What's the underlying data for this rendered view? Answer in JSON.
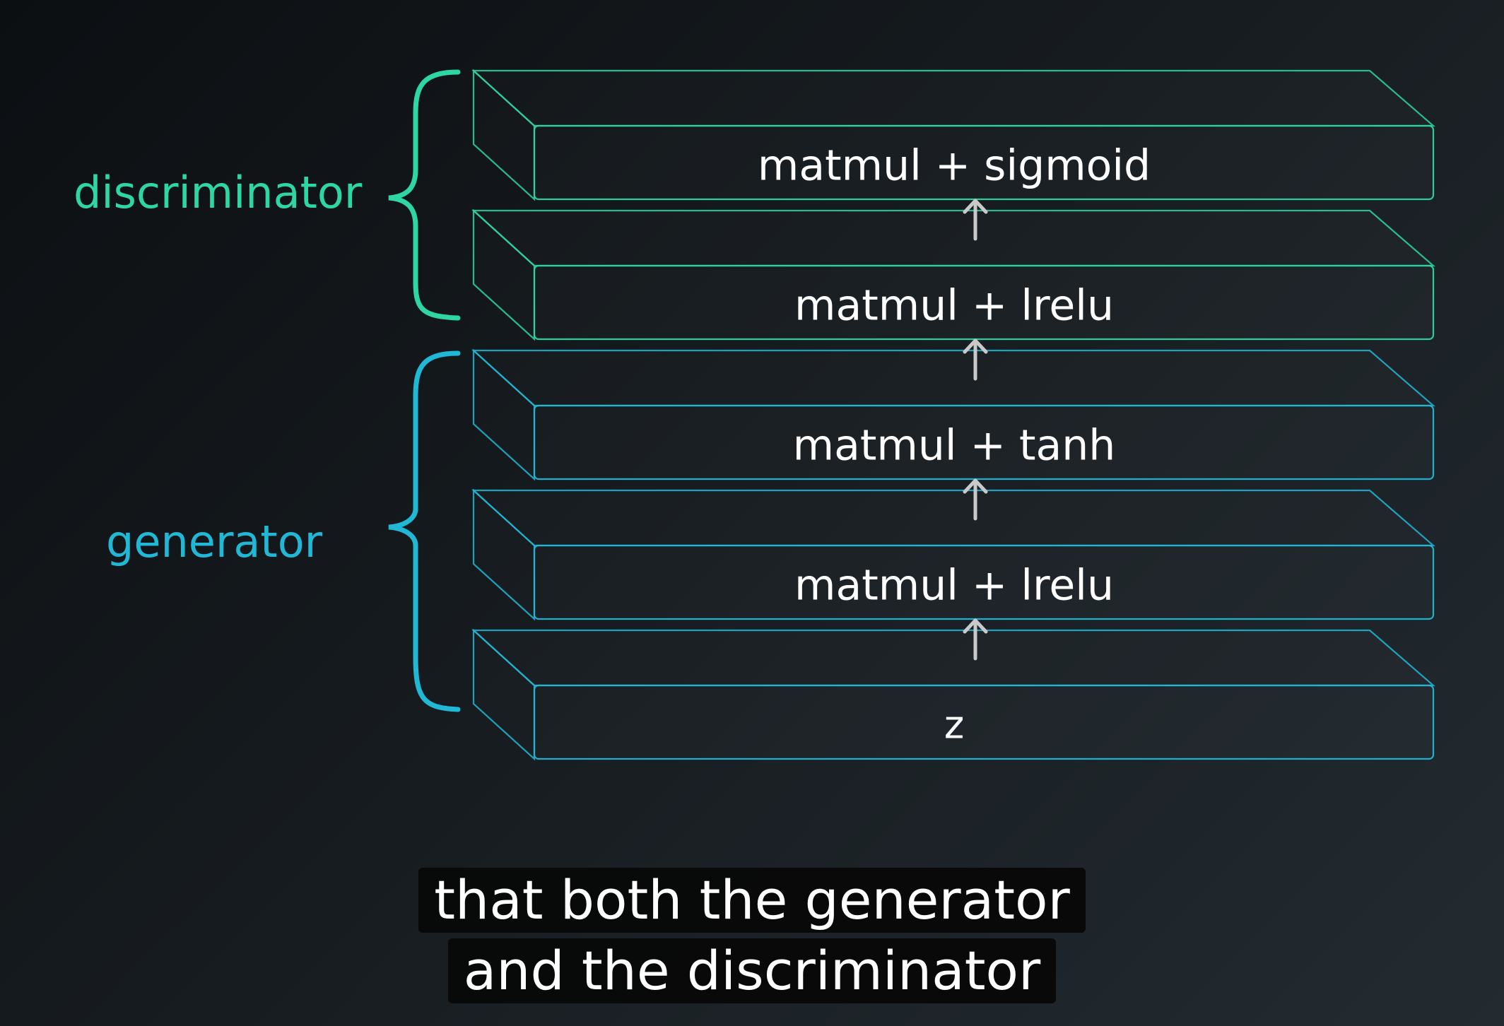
{
  "colors": {
    "discriminator": "#2ed6a4",
    "generator": "#21b8d6",
    "arrow": "#c9c9c9",
    "layer_text": "#ffffff"
  },
  "groups": {
    "discriminator_label": "discriminator",
    "generator_label": "generator"
  },
  "layers": [
    {
      "label": "matmul + sigmoid",
      "group": "discriminator"
    },
    {
      "label": "matmul + lrelu",
      "group": "discriminator"
    },
    {
      "label": "matmul + tanh",
      "group": "generator"
    },
    {
      "label": "matmul + lrelu",
      "group": "generator"
    },
    {
      "label": "z",
      "group": "generator"
    }
  ],
  "caption": {
    "line1": "that both the generator",
    "line2": "and the discriminator"
  }
}
